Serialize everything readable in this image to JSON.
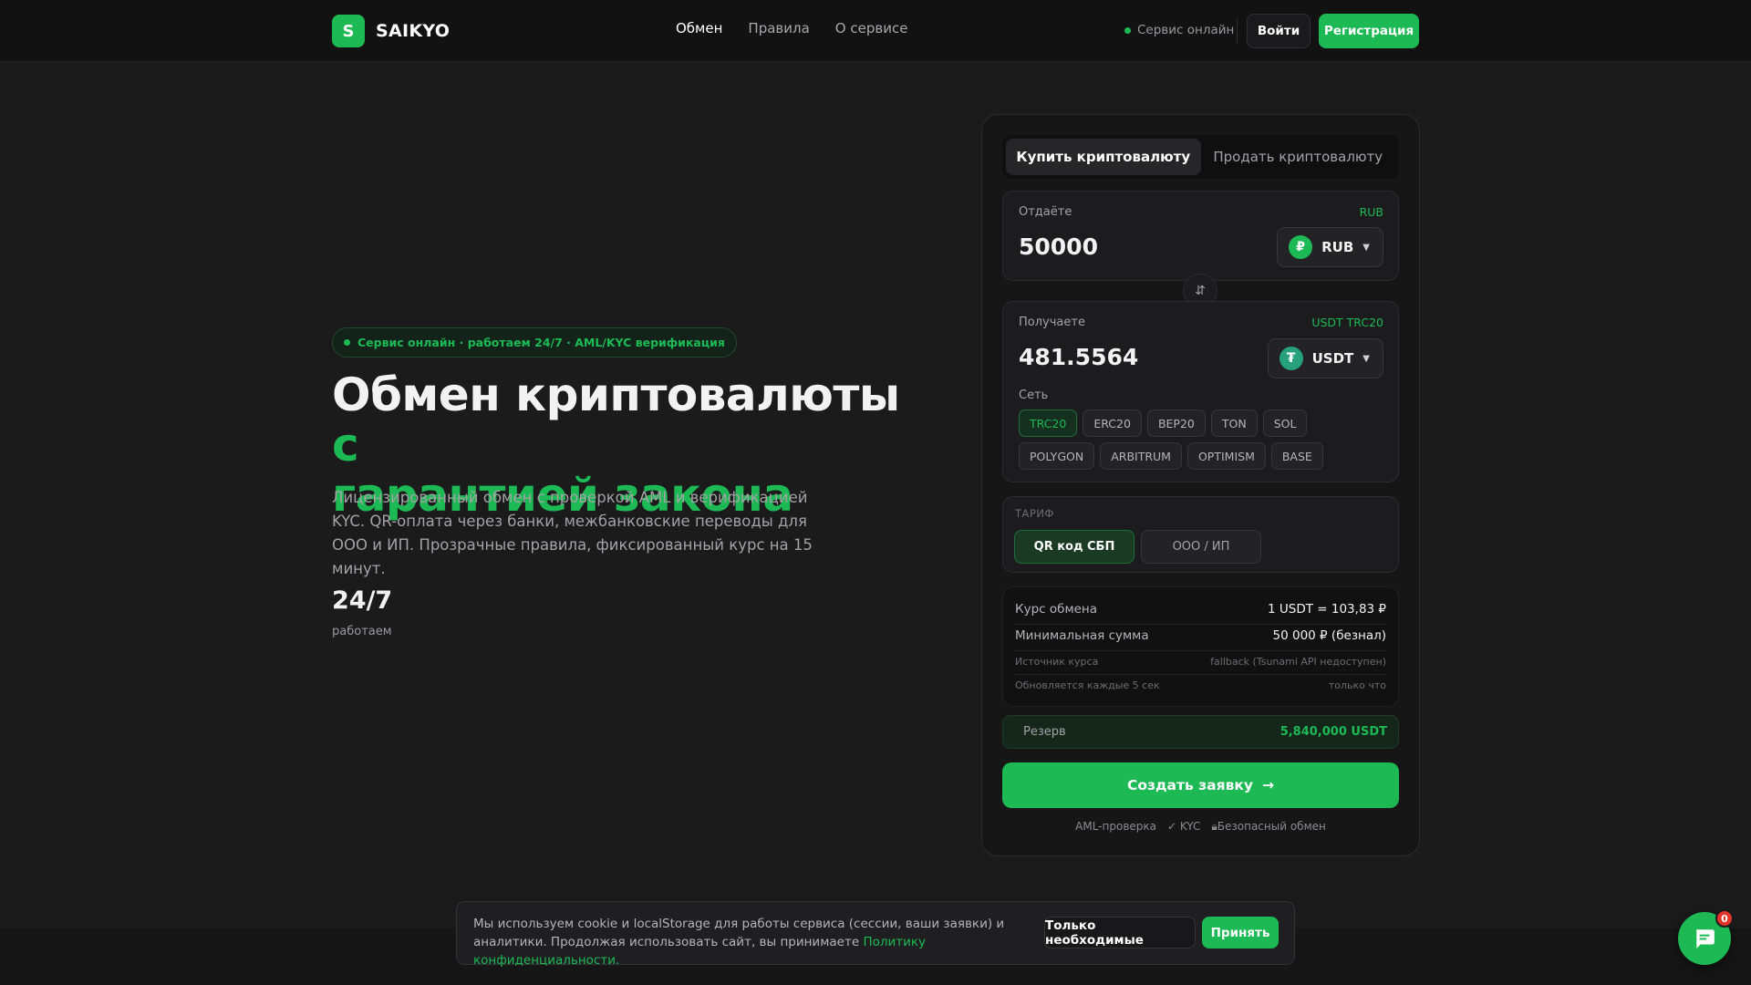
{
  "brand": {
    "logo_letter": "S",
    "name": "SAIKYO",
    "accent_color": "#1db954"
  },
  "nav": {
    "items": [
      "Обмен",
      "Правила",
      "О сервисе"
    ],
    "active_index": 0
  },
  "header": {
    "status": "Сервис онлайн",
    "login": "Войти",
    "register": "Регистрация"
  },
  "hero": {
    "badge": "Сервис онлайн · работаем 24/7 · AML/KYC верификация",
    "title_main": "Обмен криптовалюты ",
    "title_accent_1": "с",
    "title_accent_2": "гарантией закона",
    "description": "Лицензированный обмен с проверкой AML и верификацией KYC. QR-оплата через банки, межбанковские переводы для ООО и ИП. Прозрачные правила, фиксированный курс на 15 минут.",
    "stat_value": "24/7",
    "stat_label": "работаем"
  },
  "exchange": {
    "tabs": [
      "Купить криптовалюту",
      "Продать криптовалюту"
    ],
    "active_tab": 0,
    "give": {
      "label": "Отдаёте",
      "tag": "RUB",
      "amount": "50000",
      "currency": "RUB",
      "icon": "ruble-icon",
      "icon_glyph": "₽"
    },
    "swap_icon": "swap-vertical-icon",
    "receive": {
      "label": "Получаете",
      "tag": "USDT TRC20",
      "amount": "481.5564",
      "currency": "USDT",
      "icon": "tether-icon",
      "icon_glyph": "₮"
    },
    "network_label": "Сеть",
    "networks": [
      "TRC20",
      "ERC20",
      "BEP20",
      "TON",
      "SOL",
      "POLYGON",
      "ARBITRUM",
      "OPTIMISM",
      "BASE"
    ],
    "active_network": "TRC20",
    "tariff": {
      "label": "ТАРИФ",
      "options": [
        "QR код СБП",
        "ООО / ИП"
      ],
      "active_index": 0
    },
    "info": {
      "rate_label": "Курс обмена",
      "rate_value": "1 USDT = 103,83 ₽",
      "min_label": "Минимальная сумма",
      "min_value": "50 000 ₽ (безнал)",
      "source_label": "Источник курса",
      "source_value": "fallback (Tsunami API недоступен)",
      "update_label": "Обновляется каждые 5 сек",
      "update_value": "только что"
    },
    "reserve": {
      "label": "Резерв",
      "value": "5,840,000 USDT"
    },
    "create_button": "Создать заявку",
    "footnotes": [
      "AML-проверка",
      "✓ KYC",
      "Безопасный обмен"
    ]
  },
  "cookie": {
    "text": "Мы используем cookie и localStorage для работы сервиса (сессии, ваши заявки) и аналитики. Продолжая использовать сайт, вы принимаете ",
    "link": "Политику конфиденциальности.",
    "necessary": "Только необходимые",
    "accept": "Принять"
  },
  "chat": {
    "badge_count": "0",
    "icon": "chat-icon"
  }
}
